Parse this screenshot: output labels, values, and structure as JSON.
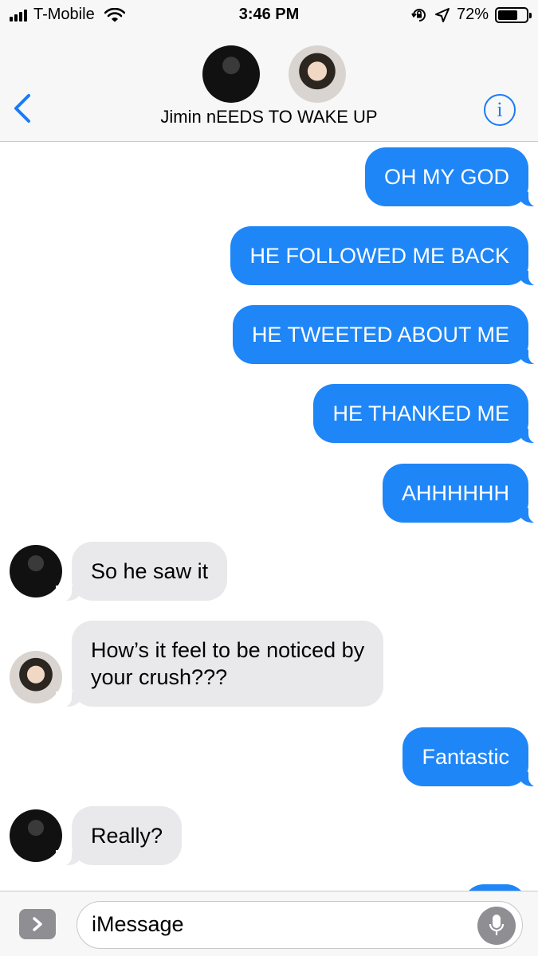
{
  "status_bar": {
    "carrier": "T-Mobile",
    "time": "3:46 PM",
    "battery": "72%",
    "battery_level": 0.72,
    "icons": [
      "signal-bars-icon",
      "wifi-icon",
      "orientation-lock-icon",
      "location-arrow-icon",
      "battery-icon"
    ]
  },
  "header": {
    "contact_name": "Jimin nEEDS TO WAKE UP",
    "back_icon": "chevron-left-icon",
    "info_label": "i"
  },
  "messages": [
    {
      "direction": "sent",
      "text": "OH MY GOD"
    },
    {
      "direction": "sent",
      "text": "HE FOLLOWED ME BACK"
    },
    {
      "direction": "sent",
      "text": "HE TWEETED ABOUT ME"
    },
    {
      "direction": "sent",
      "text": "HE THANKED ME"
    },
    {
      "direction": "sent",
      "text": "AHHHHHH"
    },
    {
      "direction": "received",
      "text": "So he saw it"
    },
    {
      "direction": "received",
      "text_line1": "How’s it feel to be noticed by",
      "text_line2": "your crush???"
    },
    {
      "direction": "sent",
      "text": "Fantastic"
    },
    {
      "direction": "received",
      "text": "Really?"
    }
  ],
  "input_bar": {
    "placeholder": "iMessage",
    "apps_icon": "chevron-right-icon",
    "mic_icon": "microphone-icon"
  },
  "colors": {
    "sent_bubble": "#1f86f7",
    "received_bubble": "#e9e9eb",
    "accent": "#1a7cf5",
    "bar_background": "#f7f7f7"
  }
}
